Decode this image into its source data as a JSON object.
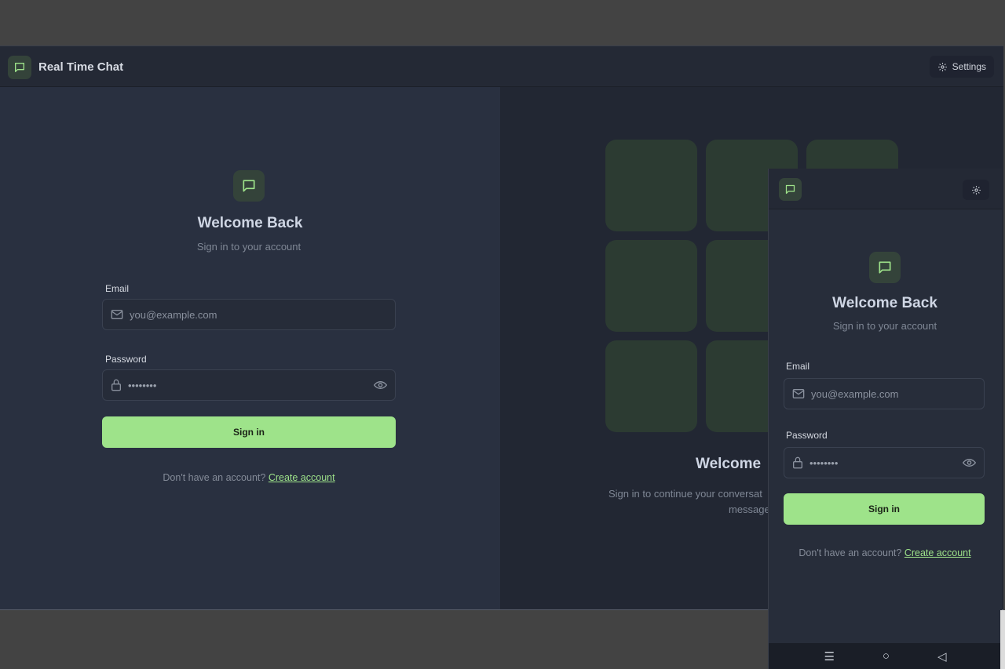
{
  "app": {
    "title": "Real Time Chat",
    "settings_label": "Settings"
  },
  "login": {
    "heading": "Welcome Back",
    "subheading": "Sign in to your account",
    "email_label": "Email",
    "email_placeholder": "you@example.com",
    "password_label": "Password",
    "password_value": "••••••••",
    "signin_label": "Sign in",
    "footer_text": "Don't have an account?",
    "create_account": "Create account"
  },
  "hero": {
    "title": "Welcome",
    "subtitle_line1": "Sign in to continue your conversat",
    "subtitle_line2": "message"
  },
  "mobile": {
    "heading": "Welcome Back",
    "subheading": "Sign in to your account",
    "email_label": "Email",
    "email_placeholder": "you@example.com",
    "password_label": "Password",
    "password_value": "••••••••",
    "signin_label": "Sign in",
    "footer_text": "Don't have an account?",
    "create_account": "Create account",
    "nav": {
      "menu": "☰",
      "home": "○",
      "back": "◁"
    }
  },
  "colors": {
    "accent": "#9ee38a",
    "bg": "#252a36",
    "tile": "#2c3b32"
  }
}
